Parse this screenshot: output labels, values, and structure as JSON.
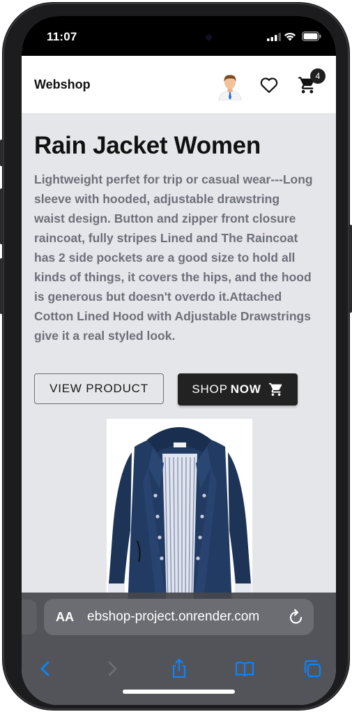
{
  "status": {
    "time": "11:07"
  },
  "nav": {
    "brand": "Webshop",
    "cart_count": "4"
  },
  "product": {
    "title": "Rain Jacket Women",
    "description": "Lightweight perfet for trip or casual wear---Long sleeve with hooded, adjustable drawstring waist design. Button and zipper front closure raincoat, fully stripes Lined and The Raincoat has 2 side pockets are a good size to hold all kinds of things, it covers the hips, and the hood is generous but doesn't overdo it.Attached Cotton Lined Hood with Adjustable Drawstrings give it a real styled look.",
    "view_label": "VIEW PRODUCT",
    "shop_label": "SHOP",
    "shop_label_bold": "NOW"
  },
  "browser": {
    "aa_label": "AA",
    "url": "ebshop-project.onrender.com"
  },
  "colors": {
    "accent_dark": "#222222",
    "page_bg": "#e5e6ea",
    "ios_blue": "#0a84ff",
    "text_gray": "#6d7079"
  }
}
